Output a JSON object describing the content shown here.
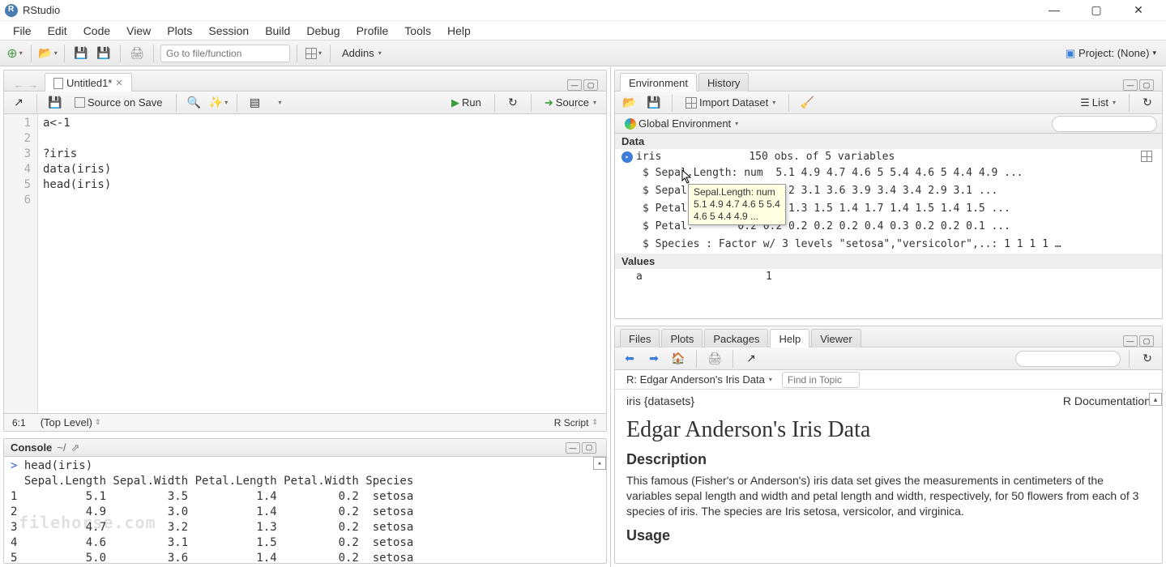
{
  "titlebar": {
    "title": "RStudio"
  },
  "menubar": [
    "File",
    "Edit",
    "Code",
    "View",
    "Plots",
    "Session",
    "Build",
    "Debug",
    "Profile",
    "Tools",
    "Help"
  ],
  "toolbar": {
    "goto_placeholder": "Go to file/function",
    "addins": "Addins",
    "project": "Project: (None)"
  },
  "source": {
    "tab_title": "Untitled1*",
    "source_on_save": "Source on Save",
    "run": "Run",
    "source_btn": "Source",
    "lines": [
      "a<-1",
      "",
      "?iris",
      "data(iris)",
      "head(iris)",
      ""
    ],
    "cursor": "6:1",
    "scope": "(Top Level)",
    "lang": "R Script"
  },
  "console": {
    "title": "Console",
    "cwd": "~/",
    "body": "> head(iris)\n  Sepal.Length Sepal.Width Petal.Length Petal.Width Species\n1          5.1         3.5          1.4         0.2  setosa\n2          4.9         3.0          1.4         0.2  setosa\n3          4.7         3.2          1.3         0.2  setosa\n4          4.6         3.1          1.5         0.2  setosa\n5          5.0         3.6          1.4         0.2  setosa"
  },
  "env": {
    "tabs": [
      "Environment",
      "History"
    ],
    "import": "Import Dataset",
    "list": "List",
    "scope": "Global Environment",
    "data_heading": "Data",
    "values_heading": "Values",
    "iris_name": "iris",
    "iris_summary": "150 obs. of 5 variables",
    "iris_details": [
      "$ Sepal.Length: num  5.1 4.9 4.7 4.6 5 5.4 4.6 5 4.4 4.9 ...",
      "$ Sepal.       3.5 3 3.2 3.1 3.6 3.9 3.4 3.4 2.9 3.1 ...",
      "$ Petal.       1.4 1.4 1.3 1.5 1.4 1.7 1.4 1.5 1.4 1.5 ...",
      "$ Petal.       0.2 0.2 0.2 0.2 0.2 0.4 0.3 0.2 0.2 0.1 ...",
      "$ Species : Factor w/ 3 levels \"setosa\",\"versicolor\",..: 1 1 1 1 …"
    ],
    "value_name": "a",
    "value_val": "1",
    "tooltip_line1": "Sepal.Length: num",
    "tooltip_line2": "5.1 4.9 4.7 4.6 5 5.4",
    "tooltip_line3": "4.6 5 4.4 4.9 ..."
  },
  "help": {
    "tabs": [
      "Files",
      "Plots",
      "Packages",
      "Help",
      "Viewer"
    ],
    "topic": "R: Edgar Anderson's Iris Data",
    "find_placeholder": "Find in Topic",
    "doc_left": "iris {datasets}",
    "doc_right": "R Documentation",
    "h1": "Edgar Anderson's Iris Data",
    "h2a": "Description",
    "desc": "This famous (Fisher's or Anderson's) iris data set gives the measurements in centimeters of the variables sepal length and width and petal length and width, respectively, for 50 flowers from each of 3 species of iris. The species are Iris setosa, versicolor, and virginica.",
    "h2b": "Usage"
  },
  "watermark": "filehorse.com"
}
